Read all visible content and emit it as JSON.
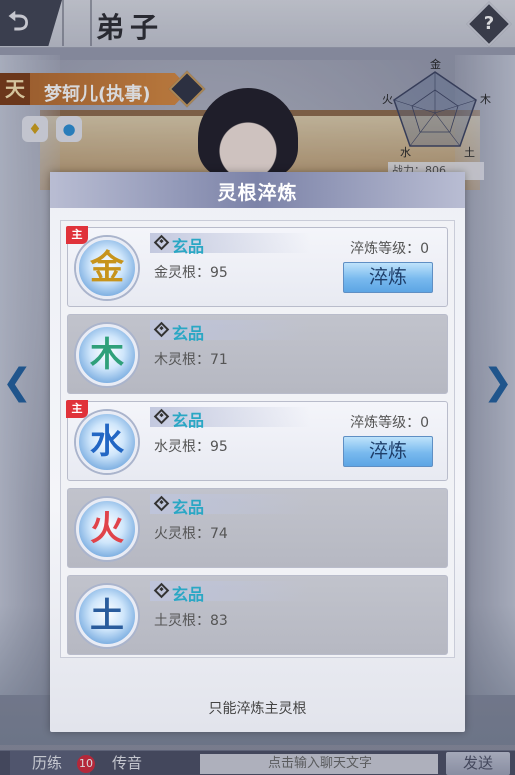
{
  "top_bar": {
    "back_icon": "back-arrow-icon",
    "title": "弟子",
    "help_label": "?"
  },
  "disciple": {
    "rank": "天",
    "name": "梦轲儿(执事)",
    "element_icons": [
      "gold-drop-icon",
      "water-drop-icon"
    ]
  },
  "radar": {
    "labels": [
      "金",
      "木",
      "土",
      "水",
      "火"
    ],
    "power_label": "战力：806"
  },
  "modal": {
    "title": "灵根淬炼",
    "roots": [
      {
        "char": "金",
        "element": "metal",
        "is_main": true,
        "grade": "玄品",
        "label": "金灵根：95",
        "refine_level": "淬炼等级：0",
        "button": "淬炼"
      },
      {
        "char": "木",
        "element": "wood",
        "is_main": false,
        "grade": "玄品",
        "label": "木灵根：71"
      },
      {
        "char": "水",
        "element": "water",
        "is_main": true,
        "grade": "玄品",
        "label": "水灵根：95",
        "refine_level": "淬炼等级：0",
        "button": "淬炼"
      },
      {
        "char": "火",
        "element": "fire",
        "is_main": false,
        "grade": "玄品",
        "label": "火灵根：74"
      },
      {
        "char": "土",
        "element": "earth",
        "is_main": false,
        "grade": "玄品",
        "label": "土灵根：83"
      }
    ],
    "main_tag": "主",
    "note": "只能淬炼主灵根"
  },
  "chat": {
    "tab_trials": "历练",
    "trials_badge": "10",
    "tab_rumor": "传音",
    "input_placeholder": "点击输入聊天文字",
    "send_label": "发送"
  },
  "colors": {
    "grade_text": "#2aa7c4",
    "refine_button": "#78b9ee",
    "main_tag": "#e0323a",
    "modal_header": "#7c83a8"
  }
}
